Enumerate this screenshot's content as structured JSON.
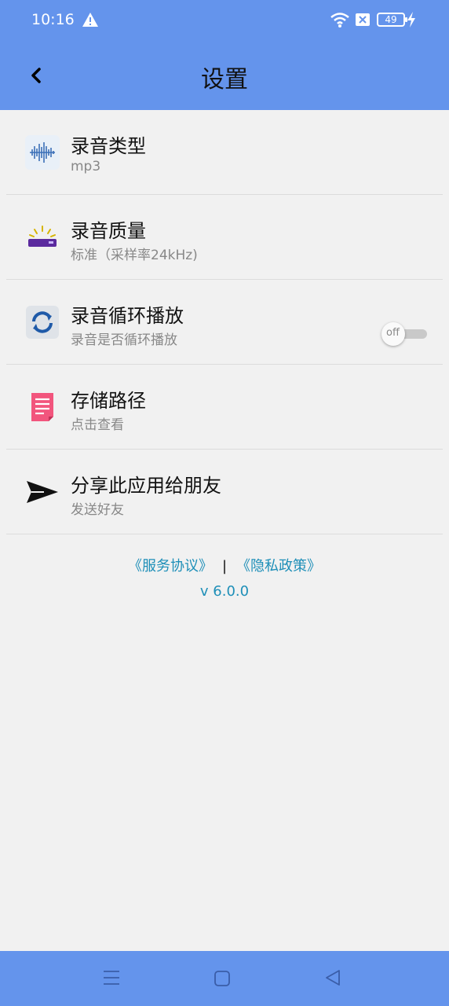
{
  "status_bar": {
    "time": "10:16",
    "battery": "49",
    "icons": [
      "alert-icon",
      "wifi-icon",
      "sim-x-icon",
      "battery-icon",
      "charging-icon"
    ]
  },
  "header": {
    "title": "设置",
    "back_icon": "chevron-left-icon"
  },
  "settings": [
    {
      "title": "录音类型",
      "subtitle": "mp3",
      "icon": "waveform-icon"
    },
    {
      "title": "录音质量",
      "subtitle": "标准（采样率24kHz)",
      "icon": "quality-icon"
    },
    {
      "title": "录音循环播放",
      "subtitle": "录音是否循环播放",
      "icon": "loop-icon",
      "toggle": {
        "label": "off",
        "state": false
      }
    },
    {
      "title": "存储路径",
      "subtitle": "点击查看",
      "icon": "document-icon"
    },
    {
      "title": "分享此应用给朋友",
      "subtitle": "发送好友",
      "icon": "send-icon"
    }
  ],
  "footer": {
    "service_link": "《服务协议》",
    "separator": "|",
    "privacy_link": "《隐私政策》",
    "version": "v 6.0.0"
  },
  "colors": {
    "accent": "#6494ec",
    "link": "#1e8fb8",
    "background": "#f1f1f1"
  }
}
